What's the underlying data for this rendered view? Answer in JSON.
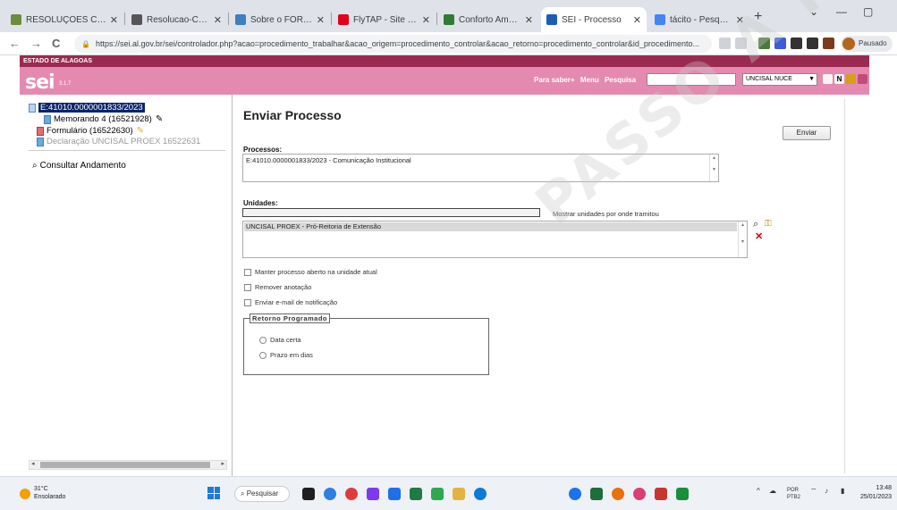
{
  "browser": {
    "tabs": [
      {
        "title": "RESOLUÇÕES CONSU",
        "favicon_color": "#6a8e3a",
        "active": false
      },
      {
        "title": "Resolucao-Consu-n°",
        "favicon_color": "#555555",
        "active": false
      },
      {
        "title": "Sobre o FORPROEX",
        "favicon_color": "#3d7fbf",
        "active": false
      },
      {
        "title": "FlyTAP - Site oficial",
        "favicon_color": "#e2001a",
        "active": false
      },
      {
        "title": "Conforto Ambiental",
        "favicon_color": "#2e7d32",
        "active": false
      },
      {
        "title": "SEI - Processo",
        "favicon_color": "#1a5fb4",
        "active": true
      },
      {
        "title": "tácito - Pesquisa Goo",
        "favicon_color": "#4285f4",
        "active": false
      }
    ],
    "new_tab_symbol": "+",
    "window_controls": [
      "⌄",
      "—",
      "▢"
    ],
    "nav": {
      "back": "←",
      "forward": "→",
      "reload": "C"
    },
    "url": "https://sei.al.gov.br/sei/controlador.php?acao=procedimento_trabalhar&acao_origem=procedimento_controlar&acao_retorno=procedimento_controlar&id_procedimento...",
    "profile_label": "Pausado"
  },
  "sei": {
    "state_label": "ESTADO DE ALAGOAS",
    "logo": "sei",
    "version": "3.1.7",
    "menu_links": [
      "Para saber+",
      "Menu",
      "Pesquisa"
    ],
    "search_placeholder": "",
    "unit_selected": "UNCISAL NUCE",
    "header_icon_colors": [
      "#f5f5f5",
      "#f5f5f5",
      "#d4a017",
      "#c44a7a"
    ],
    "tree": {
      "process": "E:41010.0000001833/2023",
      "documents": [
        {
          "label": "Memorando 4 (16521928)",
          "icon": "document-icon",
          "color": "#000000"
        },
        {
          "label": "Formulário (16522630)",
          "icon": "document-icon",
          "color": "#000000"
        },
        {
          "label": "Declaração UNCISAL PROEX 16522631",
          "icon": "document-icon",
          "color": "#999999"
        }
      ],
      "consult_link": "Consultar Andamento"
    },
    "main": {
      "title": "Enviar Processo",
      "send_button": "Enviar",
      "processes_label": "Processos:",
      "processes_value": "E:41010.0000001833/2023 - Comunicação Institucional",
      "units_label": "Unidades:",
      "units_input_value": "",
      "show_units_label": "Mostrar unidades por onde tramitou",
      "selected_unit": "UNCISAL PROEX - Pró-Reitoria de Extensão",
      "options": [
        "Manter processo aberto na unidade atual",
        "Remover anotação",
        "Enviar e-mail de notificação"
      ],
      "return_legend": "Retorno Programado",
      "return_options": [
        "Data certa",
        "Prazo em dias"
      ]
    },
    "watermark": "PASSO A PA"
  },
  "taskbar": {
    "weather_temp": "31°C",
    "weather_desc": "Ensolarado",
    "search_label": "Pesquisar",
    "apps": [
      {
        "name": "file-explorer",
        "color": "#1f1f1f"
      },
      {
        "name": "chrome",
        "color": "#2f7fe0"
      },
      {
        "name": "app-red",
        "color": "#e03a3a"
      },
      {
        "name": "app-purple",
        "color": "#7c3aed"
      },
      {
        "name": "app-blue",
        "color": "#1f6feb"
      },
      {
        "name": "excel",
        "color": "#1e7b45"
      },
      {
        "name": "app-green",
        "color": "#2fa84f"
      },
      {
        "name": "folder",
        "color": "#e3b341"
      },
      {
        "name": "edge",
        "color": "#0a7bd6"
      }
    ],
    "apps_right": [
      {
        "name": "app-blue-2",
        "color": "#1a73e8"
      },
      {
        "name": "app-dark",
        "color": "#1e6d3a"
      },
      {
        "name": "app-orange",
        "color": "#e8710a"
      },
      {
        "name": "app-pink",
        "color": "#d93f6f"
      },
      {
        "name": "app-shield",
        "color": "#c7362f"
      },
      {
        "name": "app-yellow",
        "color": "#1a8f3a"
      }
    ],
    "lang": "POR",
    "lang2": "PTB2",
    "time": "13:48",
    "date": "25/01/2023"
  }
}
